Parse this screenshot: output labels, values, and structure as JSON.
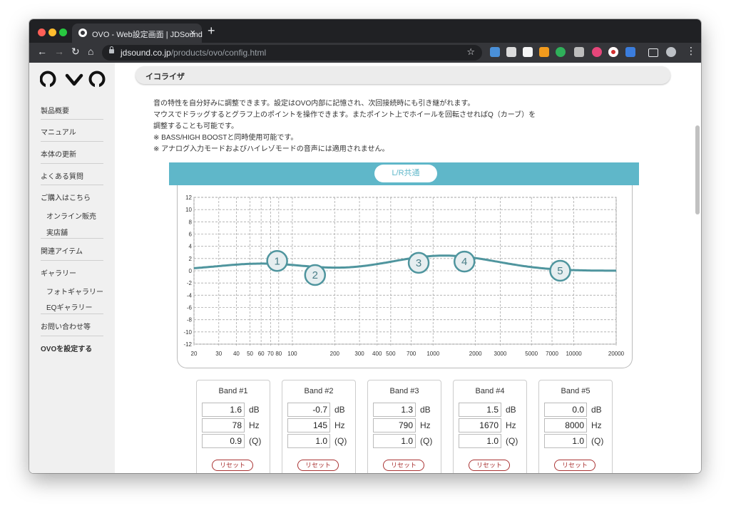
{
  "browser": {
    "tab_title": "OVO - Web設定画面 | JDSound",
    "tab_close": "×",
    "new_tab": "+",
    "url_host": "jdsound.co.jp",
    "url_path": "/products/ovo/config.html",
    "back": "←",
    "forward": "→",
    "reload": "↻",
    "home": "⌂",
    "star": "☆"
  },
  "sidebar": {
    "items": [
      "製品概要",
      "マニュアル",
      "本体の更新",
      "よくある質問",
      "ご購入はこちら",
      "オンライン販売",
      "実店舗",
      "関連アイテム",
      "ギャラリー",
      "フォトギャラリー",
      "EQギャラリー",
      "お問い合わせ等",
      "OVOを設定する"
    ]
  },
  "section": {
    "title": "イコライザ",
    "lines": [
      "音の特性を自分好みに調整できます。設定はOVO内部に記憶され、次回接続時にも引き継がれます。",
      "マウスでドラッグするとグラフ上のポイントを操作できます。またポイント上でホイールを回転させればQ（カーブ）を",
      "調整することも可能です。",
      "※ BASS/HIGH BOOSTと同時使用可能です。",
      "※ アナログ入力モードおよびハイレゾモードの音声には適用されません。"
    ]
  },
  "eq": {
    "channel_label": "L/R共通",
    "y_ticks": [
      "12",
      "10",
      "8",
      "6",
      "4",
      "2",
      "0",
      "-2",
      "-4",
      "-6",
      "-8",
      "-10",
      "-12"
    ],
    "x_ticks": [
      "20",
      "30",
      "40",
      "50",
      "60",
      "70",
      "80",
      "100",
      "200",
      "300",
      "400",
      "500",
      "700",
      "1000",
      "2000",
      "3000",
      "5000",
      "7000",
      "10000",
      "20000"
    ],
    "x_tick_values": [
      20,
      30,
      40,
      50,
      60,
      70,
      80,
      100,
      200,
      300,
      400,
      500,
      700,
      1000,
      2000,
      3000,
      5000,
      7000,
      10000,
      20000
    ],
    "y_range": [
      -12,
      12
    ],
    "x_range": [
      20,
      20000
    ],
    "x_scale": "log",
    "curve_color": "#4f959e",
    "accent_color": "#5fb7c9",
    "reset_color": "#a33333"
  },
  "bands": [
    {
      "title": "Band #1",
      "gain": "1.6",
      "freq": "78",
      "q": "0.9",
      "marker": "1"
    },
    {
      "title": "Band #2",
      "gain": "-0.7",
      "freq": "145",
      "q": "1.0",
      "marker": "2"
    },
    {
      "title": "Band #3",
      "gain": "1.3",
      "freq": "790",
      "q": "1.0",
      "marker": "3"
    },
    {
      "title": "Band #4",
      "gain": "1.5",
      "freq": "1670",
      "q": "1.0",
      "marker": "4"
    },
    {
      "title": "Band #5",
      "gain": "0.0",
      "freq": "8000",
      "q": "1.0",
      "marker": "5"
    }
  ],
  "units": {
    "gain": "dB",
    "freq": "Hz",
    "q": "(Q)"
  },
  "reset_label": "リセット"
}
